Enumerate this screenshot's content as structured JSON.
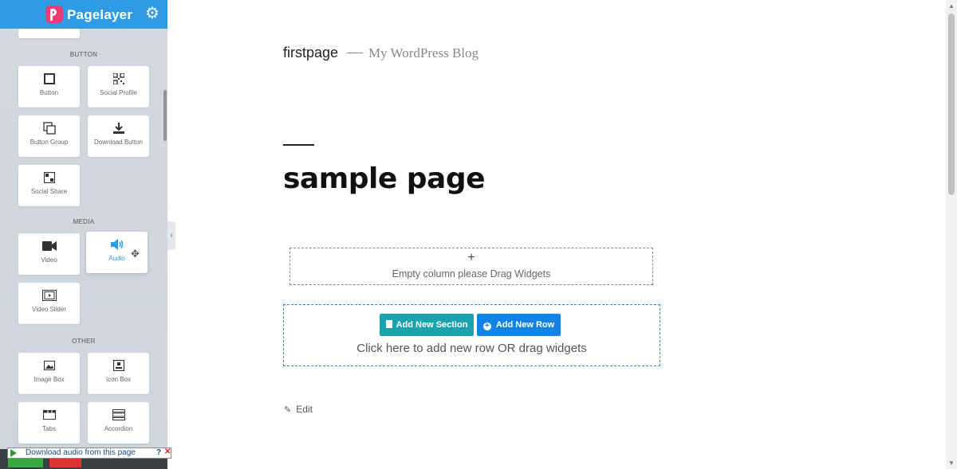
{
  "sidebar": {
    "brand": "Pagelayer",
    "sections": {
      "button": "BUTTON",
      "media": "MEDIA",
      "other": "OTHER"
    },
    "widgets": {
      "button": "Button",
      "social_profile": "Social Profile",
      "button_group": "Button Group",
      "download_button": "Download Button",
      "social_share": "Social Share",
      "video": "Video",
      "audio": "Audio",
      "video_slider": "Video Slider",
      "image_box": "Image Box",
      "icon_box": "Icon Box",
      "tabs": "Tabs",
      "accordion": "Accordion"
    },
    "active_widget": "audio"
  },
  "download_bar": {
    "text": "Download audio from this page",
    "help": "?",
    "close": "✕"
  },
  "page": {
    "site_title": "firstpage",
    "site_description": "My WordPress Blog",
    "page_title": "sample page",
    "empty_column_plus": "+",
    "empty_column_text": "Empty column please Drag Widgets",
    "add_section_label": "Add New Section",
    "add_row_label": "Add New Row",
    "add_zone_text": "Click here to add new row OR drag widgets",
    "edit_label": "Edit"
  },
  "colors": {
    "header_blue": "#2e9be4",
    "section_teal": "#18a3ad",
    "row_blue": "#1283e6",
    "logo_pink": "#ec3a73"
  }
}
